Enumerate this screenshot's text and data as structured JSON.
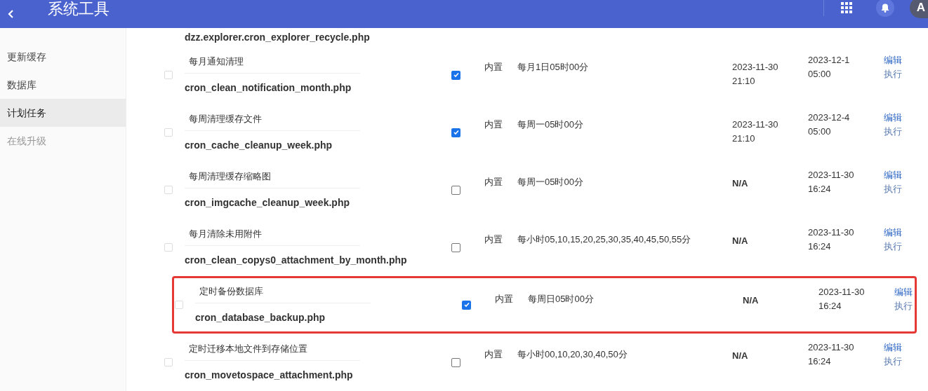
{
  "header": {
    "title": "系统工具",
    "avatar": "A"
  },
  "sidebar": {
    "items": [
      {
        "label": "更新缓存",
        "selected": false,
        "disabled": false
      },
      {
        "label": "数据库",
        "selected": false,
        "disabled": false
      },
      {
        "label": "计划任务",
        "selected": true,
        "disabled": false
      },
      {
        "label": "在线升级",
        "selected": false,
        "disabled": true
      }
    ]
  },
  "partial_row": {
    "filename": "dzz.explorer.cron_explorer_recycle.php"
  },
  "rows": [
    {
      "title": "每月通知清理",
      "filename": "cron_clean_notification_month.php",
      "enabled": true,
      "type": "内置",
      "schedule": "每月1日05时00分",
      "last_run": [
        "2023-11-30",
        "21:10"
      ],
      "next_run": [
        "2023-12-1",
        "05:00"
      ],
      "actions": [
        "编辑",
        "执行"
      ],
      "highlighted": false,
      "row_checked": false
    },
    {
      "title": "每周清理缓存文件",
      "filename": "cron_cache_cleanup_week.php",
      "enabled": true,
      "type": "内置",
      "schedule": "每周一05时00分",
      "last_run": [
        "2023-11-30",
        "21:10"
      ],
      "next_run": [
        "2023-12-4",
        "05:00"
      ],
      "actions": [
        "编辑",
        "执行"
      ],
      "highlighted": false,
      "row_checked": false
    },
    {
      "title": "每周清理缓存缩略图",
      "filename": "cron_imgcache_cleanup_week.php",
      "enabled": false,
      "type": "内置",
      "schedule": "每周一05时00分",
      "last_run": [
        "N/A"
      ],
      "next_run": [
        "2023-11-30",
        "16:24"
      ],
      "actions": [
        "编辑",
        "执行"
      ],
      "highlighted": false,
      "row_checked": false
    },
    {
      "title": "每月清除未用附件",
      "filename": "cron_clean_copys0_attachment_by_month.php",
      "enabled": false,
      "type": "内置",
      "schedule": "每小时05,10,15,20,25,30,35,40,45,50,55分",
      "last_run": [
        "N/A"
      ],
      "next_run": [
        "2023-11-30",
        "16:24"
      ],
      "actions": [
        "编辑",
        "执行"
      ],
      "highlighted": false,
      "row_checked": false
    },
    {
      "title": "定时备份数据库",
      "filename": "cron_database_backup.php",
      "enabled": true,
      "type": "内置",
      "schedule": "每周日05时00分",
      "last_run": [
        "N/A"
      ],
      "next_run": [
        "2023-11-30",
        "16:24"
      ],
      "actions": [
        "编辑",
        "执行"
      ],
      "highlighted": true,
      "row_checked": false
    },
    {
      "title": "定时迁移本地文件到存储位置",
      "filename": "cron_movetospace_attachment.php",
      "enabled": false,
      "type": "内置",
      "schedule": "每小时00,10,20,30,40,50分",
      "last_run": [
        "N/A"
      ],
      "next_run": [
        "2023-11-30",
        "16:24"
      ],
      "actions": [
        "编辑",
        "执行"
      ],
      "highlighted": false,
      "row_checked": false
    }
  ]
}
